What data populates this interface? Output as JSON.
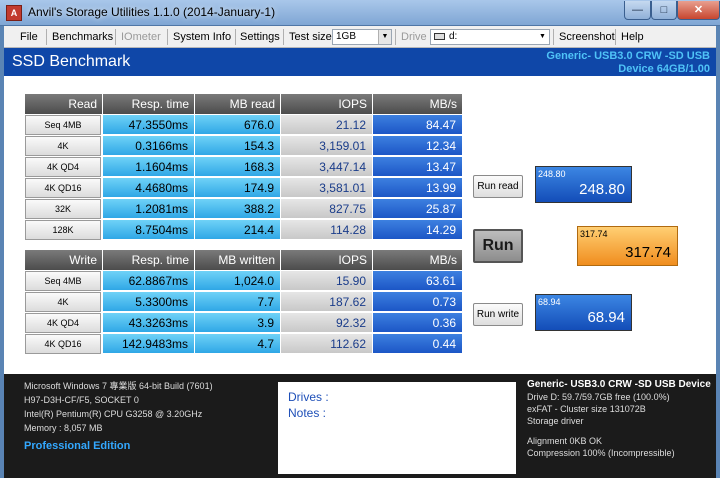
{
  "window": {
    "title": "Anvil's Storage Utilities 1.1.0 (2014-January-1)",
    "min_glyph": "—",
    "max_glyph": "□",
    "close_glyph": "✕"
  },
  "menu": {
    "file": "File",
    "benchmarks": "Benchmarks",
    "iometer": "IOmeter",
    "system_info": "System Info",
    "settings": "Settings",
    "test_size_label": "Test size",
    "test_size_value": "1GB",
    "drive_label": "Drive",
    "drive_value": "d:",
    "screenshot": "Screenshot",
    "help": "Help"
  },
  "header": {
    "title": "SSD Benchmark",
    "device_line1": "Generic- USB3.0 CRW   -SD USB",
    "device_line2": "Device 64GB/1.00"
  },
  "read_table": {
    "headers": [
      "Read",
      "Resp. time",
      "MB read",
      "IOPS",
      "MB/s"
    ],
    "rows": [
      [
        "Seq 4MB",
        "47.3550ms",
        "676.0",
        "21.12",
        "84.47"
      ],
      [
        "4K",
        "0.3166ms",
        "154.3",
        "3,159.01",
        "12.34"
      ],
      [
        "4K QD4",
        "1.1604ms",
        "168.3",
        "3,447.14",
        "13.47"
      ],
      [
        "4K QD16",
        "4.4680ms",
        "174.9",
        "3,581.01",
        "13.99"
      ],
      [
        "32K",
        "1.2081ms",
        "388.2",
        "827.75",
        "25.87"
      ],
      [
        "128K",
        "8.7504ms",
        "214.4",
        "114.28",
        "14.29"
      ]
    ]
  },
  "write_table": {
    "headers": [
      "Write",
      "Resp. time",
      "MB written",
      "IOPS",
      "MB/s"
    ],
    "rows": [
      [
        "Seq 4MB",
        "62.8867ms",
        "1,024.0",
        "15.90",
        "63.61"
      ],
      [
        "4K",
        "5.3300ms",
        "7.7",
        "187.62",
        "0.73"
      ],
      [
        "4K QD4",
        "43.3263ms",
        "3.9",
        "92.32",
        "0.36"
      ],
      [
        "4K QD16",
        "142.9483ms",
        "4.7",
        "112.62",
        "0.44"
      ]
    ]
  },
  "buttons": {
    "run_read": "Run read",
    "run": "Run",
    "run_write": "Run write"
  },
  "scores": {
    "read_small": "248.80",
    "read_big": "248.80",
    "total_small": "317.74",
    "total_big": "317.74",
    "write_small": "68.94",
    "write_big": "68.94"
  },
  "system": {
    "os": "Microsoft Windows 7 專業版  64-bit Build (7601)",
    "board": "H97-D3H-CF/F5, SOCKET 0",
    "cpu": "Intel(R) Pentium(R) CPU G3258 @ 3.20GHz",
    "memory": "Memory : 8,057 MB",
    "edition": "Professional Edition"
  },
  "notes": {
    "drives": "Drives :",
    "notes": "Notes :"
  },
  "device_info": {
    "title": "Generic- USB3.0 CRW   -SD USB Device",
    "drive": "Drive D: 59.7/59.7GB free (100.0%)",
    "fs": "exFAT - Cluster size 131072B",
    "driver": "Storage driver",
    "alignment": "Alignment 0KB OK",
    "compression": "Compression 100% (Incompressible)"
  },
  "colors": {
    "header_blue": "#0f47a8",
    "device_text": "#4fc3f7",
    "total_score": "#f4a23a",
    "score_blue": "#1c56c6"
  }
}
